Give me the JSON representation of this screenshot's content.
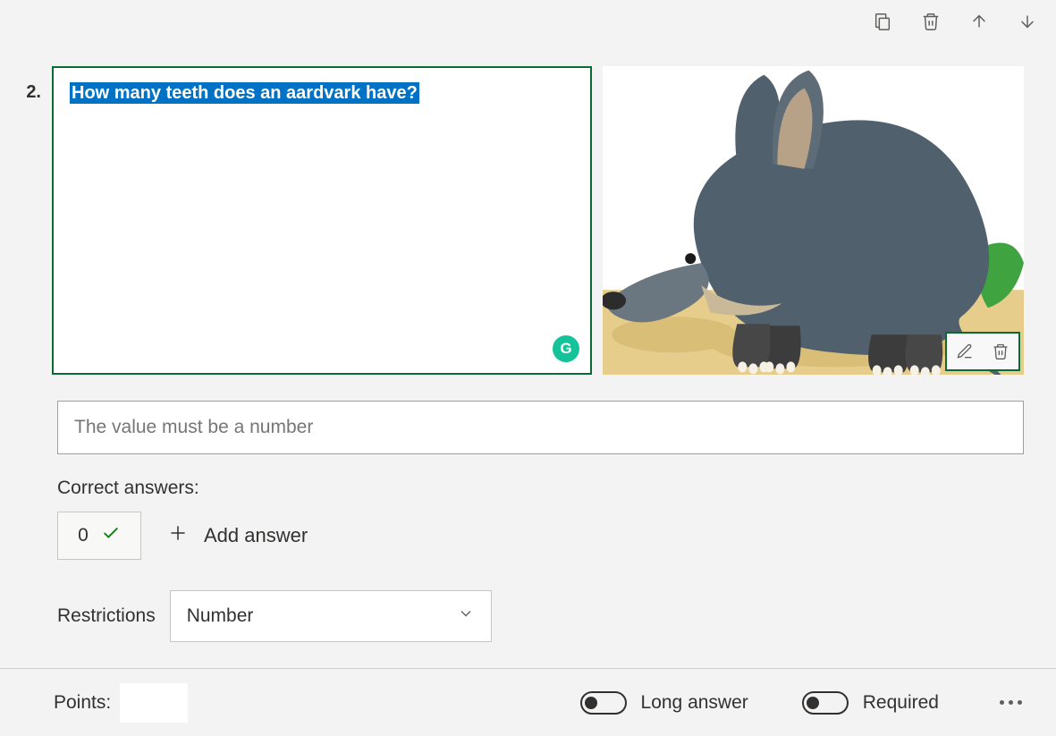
{
  "question": {
    "number": "2.",
    "text": "How many teeth does an aardvark have?"
  },
  "validation_message": "The value must be a number",
  "correct_answers": {
    "label": "Correct answers:",
    "values": [
      "0"
    ],
    "add_label": "Add answer"
  },
  "restrictions": {
    "label": "Restrictions",
    "selected": "Number"
  },
  "footer": {
    "points_label": "Points:",
    "points_value": "",
    "long_answer_label": "Long answer",
    "long_answer_on": false,
    "required_label": "Required",
    "required_on": false
  },
  "image": {
    "subject": "aardvark",
    "alt": "Illustration of an aardvark"
  }
}
